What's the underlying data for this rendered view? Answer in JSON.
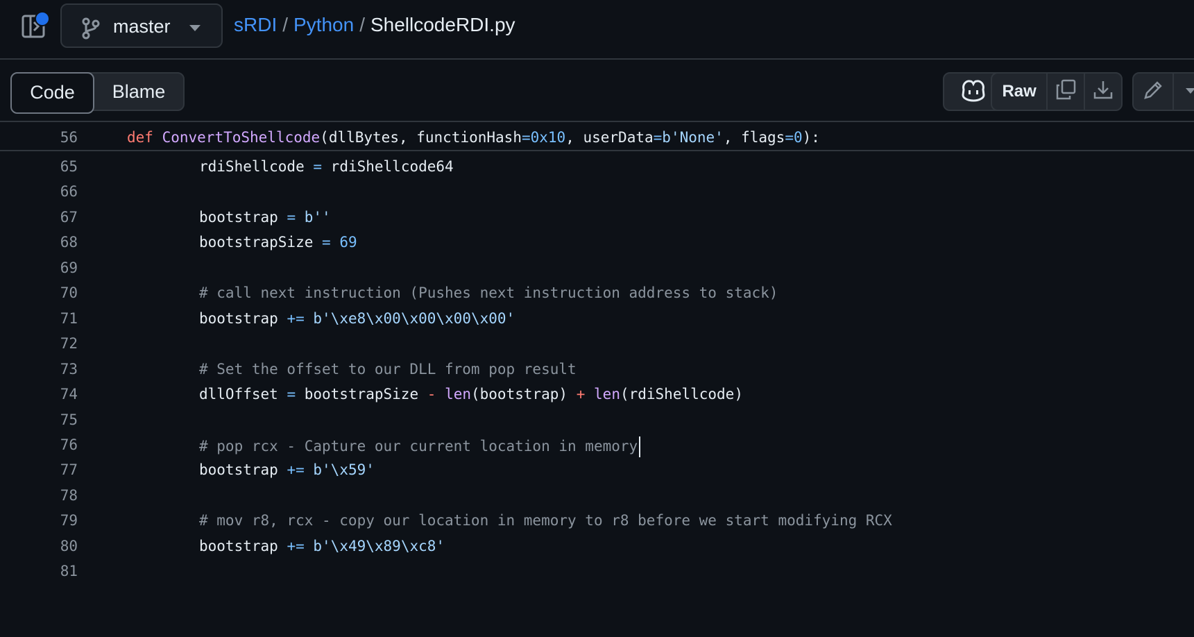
{
  "header": {
    "branch": "master",
    "breadcrumb": {
      "repo": "sRDI",
      "sep1": "/",
      "folder": "Python",
      "sep2": "/",
      "file": "ShellcodeRDI.py"
    }
  },
  "toolbar": {
    "tab_code": "Code",
    "tab_blame": "Blame",
    "raw_label": "Raw"
  },
  "icons": {
    "panel": "sidebar-toggle-icon",
    "branch": "git-branch-icon",
    "caret": "triangle-down-icon",
    "copilot": "copilot-icon",
    "copy": "copy-icon",
    "download": "download-icon",
    "edit": "pencil-icon",
    "more": "triangle-down-icon"
  },
  "colors": {
    "link": "#4493f8",
    "keyword": "#ff7b72",
    "function": "#d2a8ff",
    "constant": "#79c0ff",
    "string": "#a5d6ff",
    "comment": "#8b949e",
    "notification": "#1f6feb"
  },
  "sticky": {
    "line_number": "56",
    "tokens": [
      {
        "t": "def",
        "c": "kw"
      },
      {
        "t": " "
      },
      {
        "t": "ConvertToShellcode",
        "c": "fn"
      },
      {
        "t": "(dllBytes, functionHash"
      },
      {
        "t": "=",
        "c": "op"
      },
      {
        "t": "0x10",
        "c": "num"
      },
      {
        "t": ", userData"
      },
      {
        "t": "=",
        "c": "op"
      },
      {
        "t": "b'None'",
        "c": "str"
      },
      {
        "t": ", flags"
      },
      {
        "t": "=",
        "c": "op"
      },
      {
        "t": "0",
        "c": "num"
      },
      {
        "t": "):"
      }
    ]
  },
  "code_lines": [
    {
      "n": "65",
      "tokens": [
        {
          "t": "rdiShellcode "
        },
        {
          "t": "=",
          "c": "op"
        },
        {
          "t": " rdiShellcode64"
        }
      ]
    },
    {
      "n": "66",
      "tokens": []
    },
    {
      "n": "67",
      "tokens": [
        {
          "t": "bootstrap "
        },
        {
          "t": "=",
          "c": "op"
        },
        {
          "t": " "
        },
        {
          "t": "b''",
          "c": "str"
        }
      ]
    },
    {
      "n": "68",
      "tokens": [
        {
          "t": "bootstrapSize "
        },
        {
          "t": "=",
          "c": "op"
        },
        {
          "t": " "
        },
        {
          "t": "69",
          "c": "num"
        }
      ]
    },
    {
      "n": "69",
      "tokens": []
    },
    {
      "n": "70",
      "tokens": [
        {
          "t": "# call next instruction (Pushes next instruction address to stack)",
          "c": "cm"
        }
      ]
    },
    {
      "n": "71",
      "tokens": [
        {
          "t": "bootstrap "
        },
        {
          "t": "+=",
          "c": "op"
        },
        {
          "t": " "
        },
        {
          "t": "b'\\xe8\\x00\\x00\\x00\\x00'",
          "c": "str"
        }
      ]
    },
    {
      "n": "72",
      "tokens": []
    },
    {
      "n": "73",
      "tokens": [
        {
          "t": "# Set the offset to our DLL from pop result",
          "c": "cm"
        }
      ]
    },
    {
      "n": "74",
      "tokens": [
        {
          "t": "dllOffset "
        },
        {
          "t": "=",
          "c": "op"
        },
        {
          "t": " bootstrapSize "
        },
        {
          "t": "-",
          "c": "kw"
        },
        {
          "t": " "
        },
        {
          "t": "len",
          "c": "bi"
        },
        {
          "t": "(bootstrap) "
        },
        {
          "t": "+",
          "c": "kw"
        },
        {
          "t": " "
        },
        {
          "t": "len",
          "c": "bi"
        },
        {
          "t": "(rdiShellcode)"
        }
      ]
    },
    {
      "n": "75",
      "tokens": []
    },
    {
      "n": "76",
      "tokens": [
        {
          "t": "# pop rcx - Capture our current location in memory",
          "c": "cm"
        }
      ],
      "cursor": true
    },
    {
      "n": "77",
      "tokens": [
        {
          "t": "bootstrap "
        },
        {
          "t": "+=",
          "c": "op"
        },
        {
          "t": " "
        },
        {
          "t": "b'\\x59'",
          "c": "str"
        }
      ]
    },
    {
      "n": "78",
      "tokens": []
    },
    {
      "n": "79",
      "tokens": [
        {
          "t": "# mov r8, rcx - copy our location in memory to r8 before we start modifying RCX",
          "c": "cm"
        }
      ]
    },
    {
      "n": "80",
      "tokens": [
        {
          "t": "bootstrap "
        },
        {
          "t": "+=",
          "c": "op"
        },
        {
          "t": " "
        },
        {
          "t": "b'\\x49\\x89\\xc8'",
          "c": "str"
        }
      ]
    },
    {
      "n": "81",
      "tokens": []
    }
  ]
}
